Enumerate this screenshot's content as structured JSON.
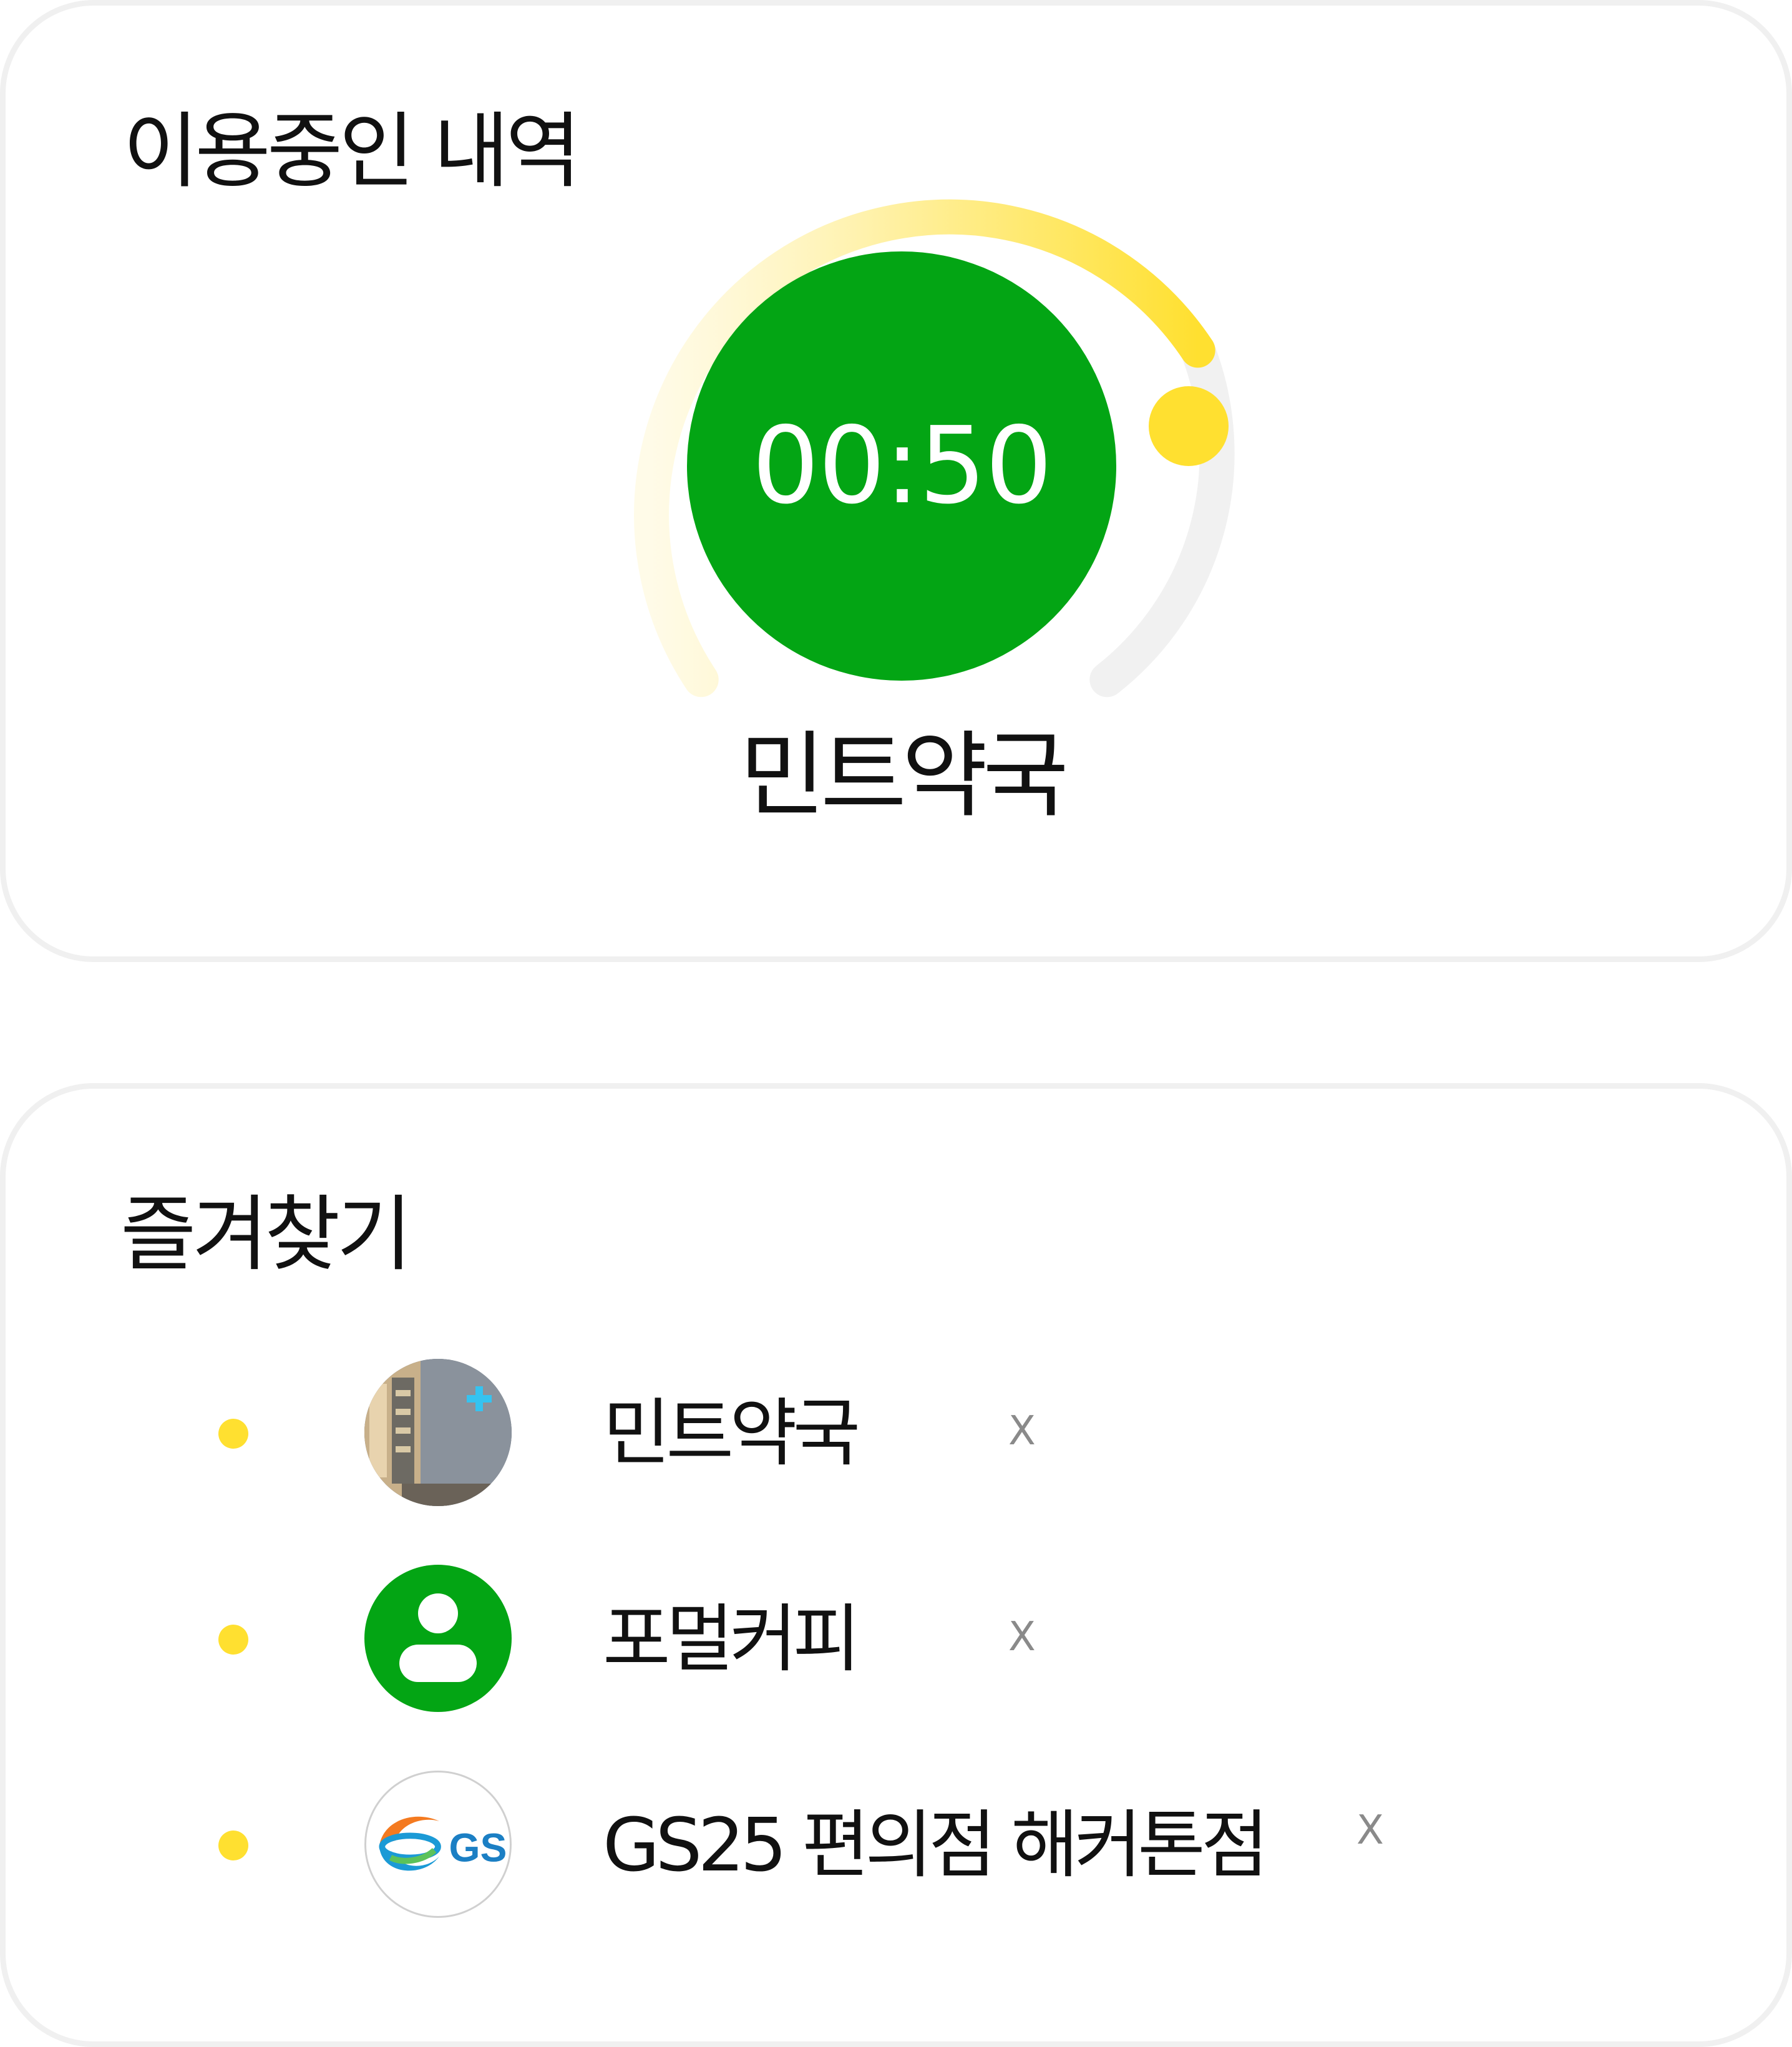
{
  "usage": {
    "title": "이용중인 내역",
    "timer": "00:50",
    "store_name": "민트약국",
    "progress_fraction": 0.56
  },
  "favorites": {
    "title": "즐겨찾기",
    "items": [
      {
        "name": "민트약국",
        "avatar": "store-photo",
        "remove_label": "X"
      },
      {
        "name": "포멀커피",
        "avatar": "user-icon",
        "remove_label": "X"
      },
      {
        "name": "GS25 편의점 해커톤점",
        "avatar": "gs-logo",
        "remove_label": "X",
        "logo_text": "GS"
      }
    ]
  },
  "colors": {
    "accent_green": "#03a514",
    "accent_yellow": "#ffe030",
    "track_gray": "#f1f1f1",
    "text": "#111111"
  }
}
